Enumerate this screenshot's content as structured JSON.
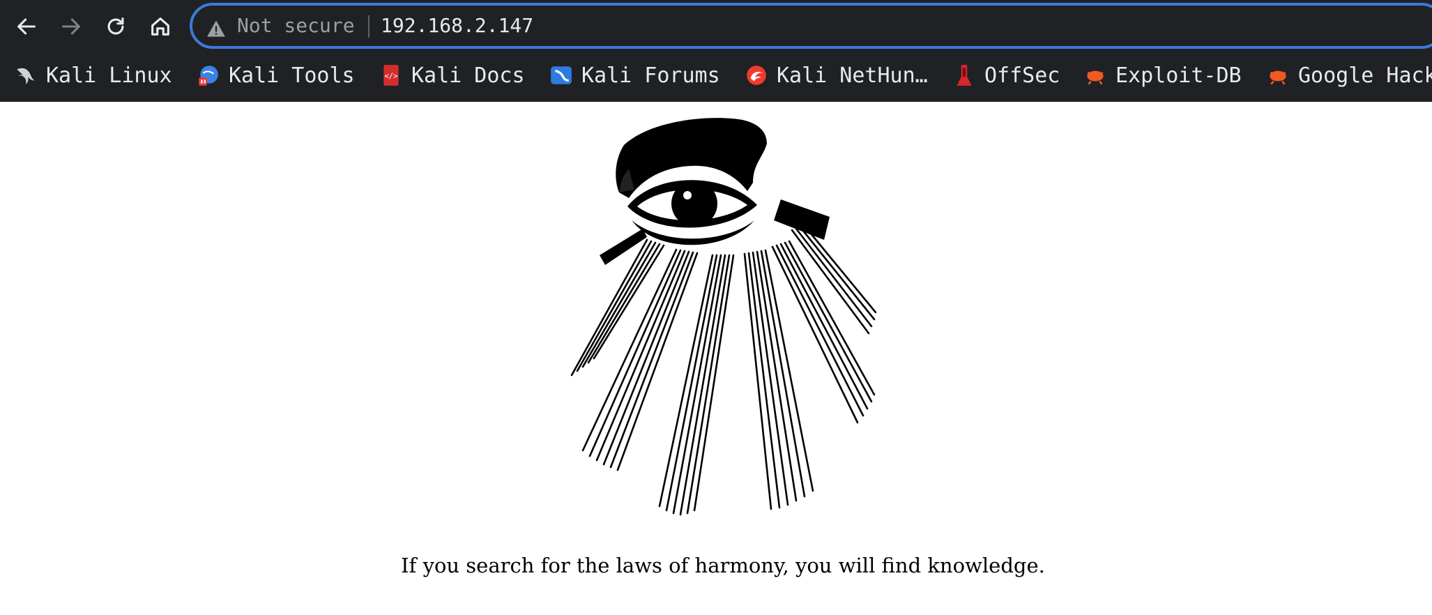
{
  "browser": {
    "security_label": "Not secure",
    "url": "192.168.2.147"
  },
  "bookmarks": [
    {
      "label": "Kali Linux",
      "icon": "kali-dragon-icon"
    },
    {
      "label": "Kali Tools",
      "icon": "kali-tools-icon"
    },
    {
      "label": "Kali Docs",
      "icon": "kali-docs-icon"
    },
    {
      "label": "Kali Forums",
      "icon": "kali-forums-icon"
    },
    {
      "label": "Kali NetHun…",
      "icon": "kali-nethunter-icon"
    },
    {
      "label": "OffSec",
      "icon": "offsec-icon"
    },
    {
      "label": "Exploit-DB",
      "icon": "exploit-db-icon"
    },
    {
      "label": "Google Hack",
      "icon": "google-hacking-db-icon"
    }
  ],
  "page": {
    "caption": "If you search for the laws of harmony, you will find knowledge."
  },
  "colors": {
    "toolbar_bg": "#202124",
    "omnibox_border": "#3b7bd9",
    "text_light": "#e8eaed",
    "text_dim": "#9aa0a6",
    "page_bg": "#ffffff"
  }
}
